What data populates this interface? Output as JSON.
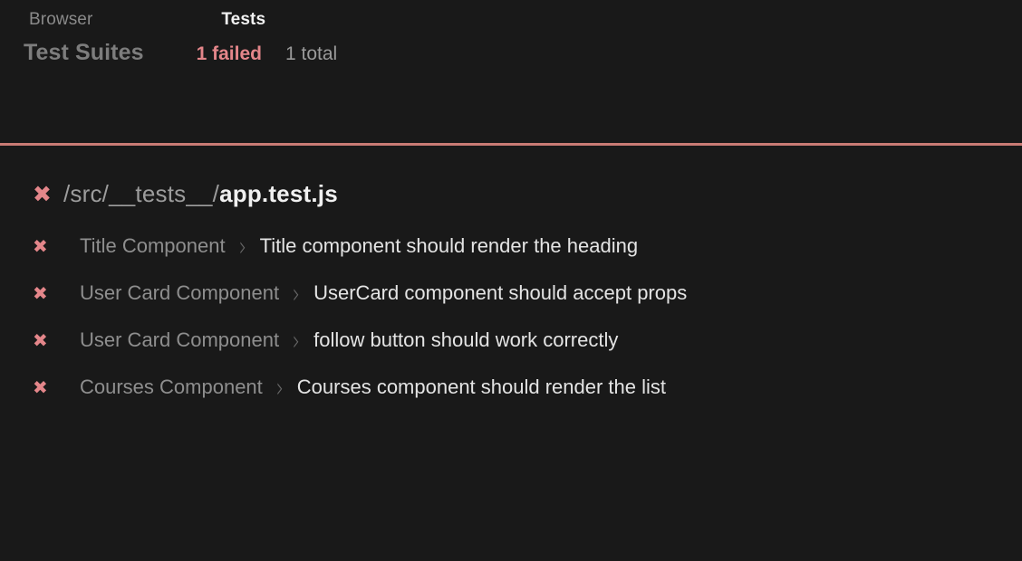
{
  "tabs": [
    {
      "label": "Browser",
      "active": false
    },
    {
      "label": "Tests",
      "active": true
    }
  ],
  "summary": {
    "label": "Test Suites",
    "failed": "1 failed",
    "total": "1 total"
  },
  "colors": {
    "background": "#191919",
    "divider": "#c97b75",
    "fail": "#e4868a",
    "muted": "#8e8e8e",
    "text": "#e4e4e4"
  },
  "suite": {
    "status_icon": "fail-x-icon",
    "status_glyph": "✖",
    "path_dir": "/src/__tests__/",
    "path_file": "app.test.js"
  },
  "tests": [
    {
      "status_glyph": "✖",
      "suite_name": "Title Component",
      "separator": "›",
      "title": "Title component should render the heading"
    },
    {
      "status_glyph": "✖",
      "suite_name": "User Card Component",
      "separator": "›",
      "title": "UserCard component should accept props"
    },
    {
      "status_glyph": "✖",
      "suite_name": "User Card Component",
      "separator": "›",
      "title": "follow button should work correctly"
    },
    {
      "status_glyph": "✖",
      "suite_name": "Courses Component",
      "separator": "›",
      "title": "Courses component should render the list"
    }
  ]
}
